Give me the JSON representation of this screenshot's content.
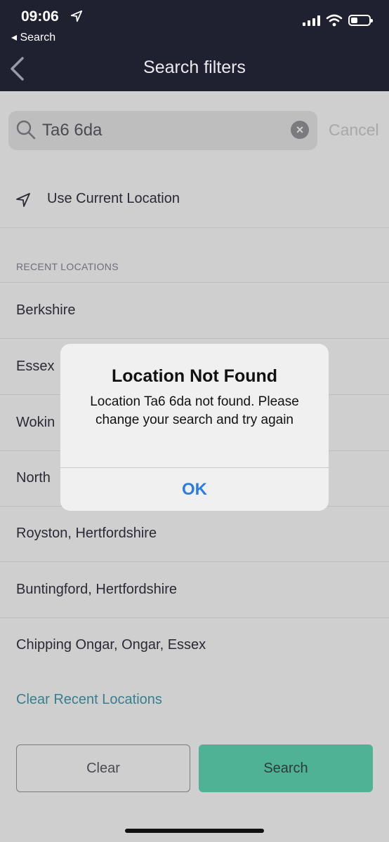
{
  "status_bar": {
    "time": "09:06",
    "back_app": "◂ Search"
  },
  "nav": {
    "title": "Search filters"
  },
  "search": {
    "value": "Ta6 6da",
    "cancel_label": "Cancel"
  },
  "current_location": {
    "label": "Use Current Location"
  },
  "recent": {
    "header": "RECENT LOCATIONS",
    "items": [
      "Berkshire",
      "Essex",
      "Wokin",
      "North",
      "Royston, Hertfordshire",
      "Buntingford, Hertfordshire",
      "Chipping Ongar, Ongar, Essex"
    ],
    "clear_label": "Clear Recent Locations"
  },
  "footer": {
    "clear_label": "Clear",
    "search_label": "Search"
  },
  "dialog": {
    "title": "Location Not Found",
    "message": "Location Ta6 6da not found. Please change your search and try again",
    "ok_label": "OK"
  },
  "colors": {
    "header_bg": "#1f2030",
    "accent_green": "#4fb294",
    "link_teal": "#3a7e8c",
    "dialog_button_blue": "#2f7bdc"
  }
}
